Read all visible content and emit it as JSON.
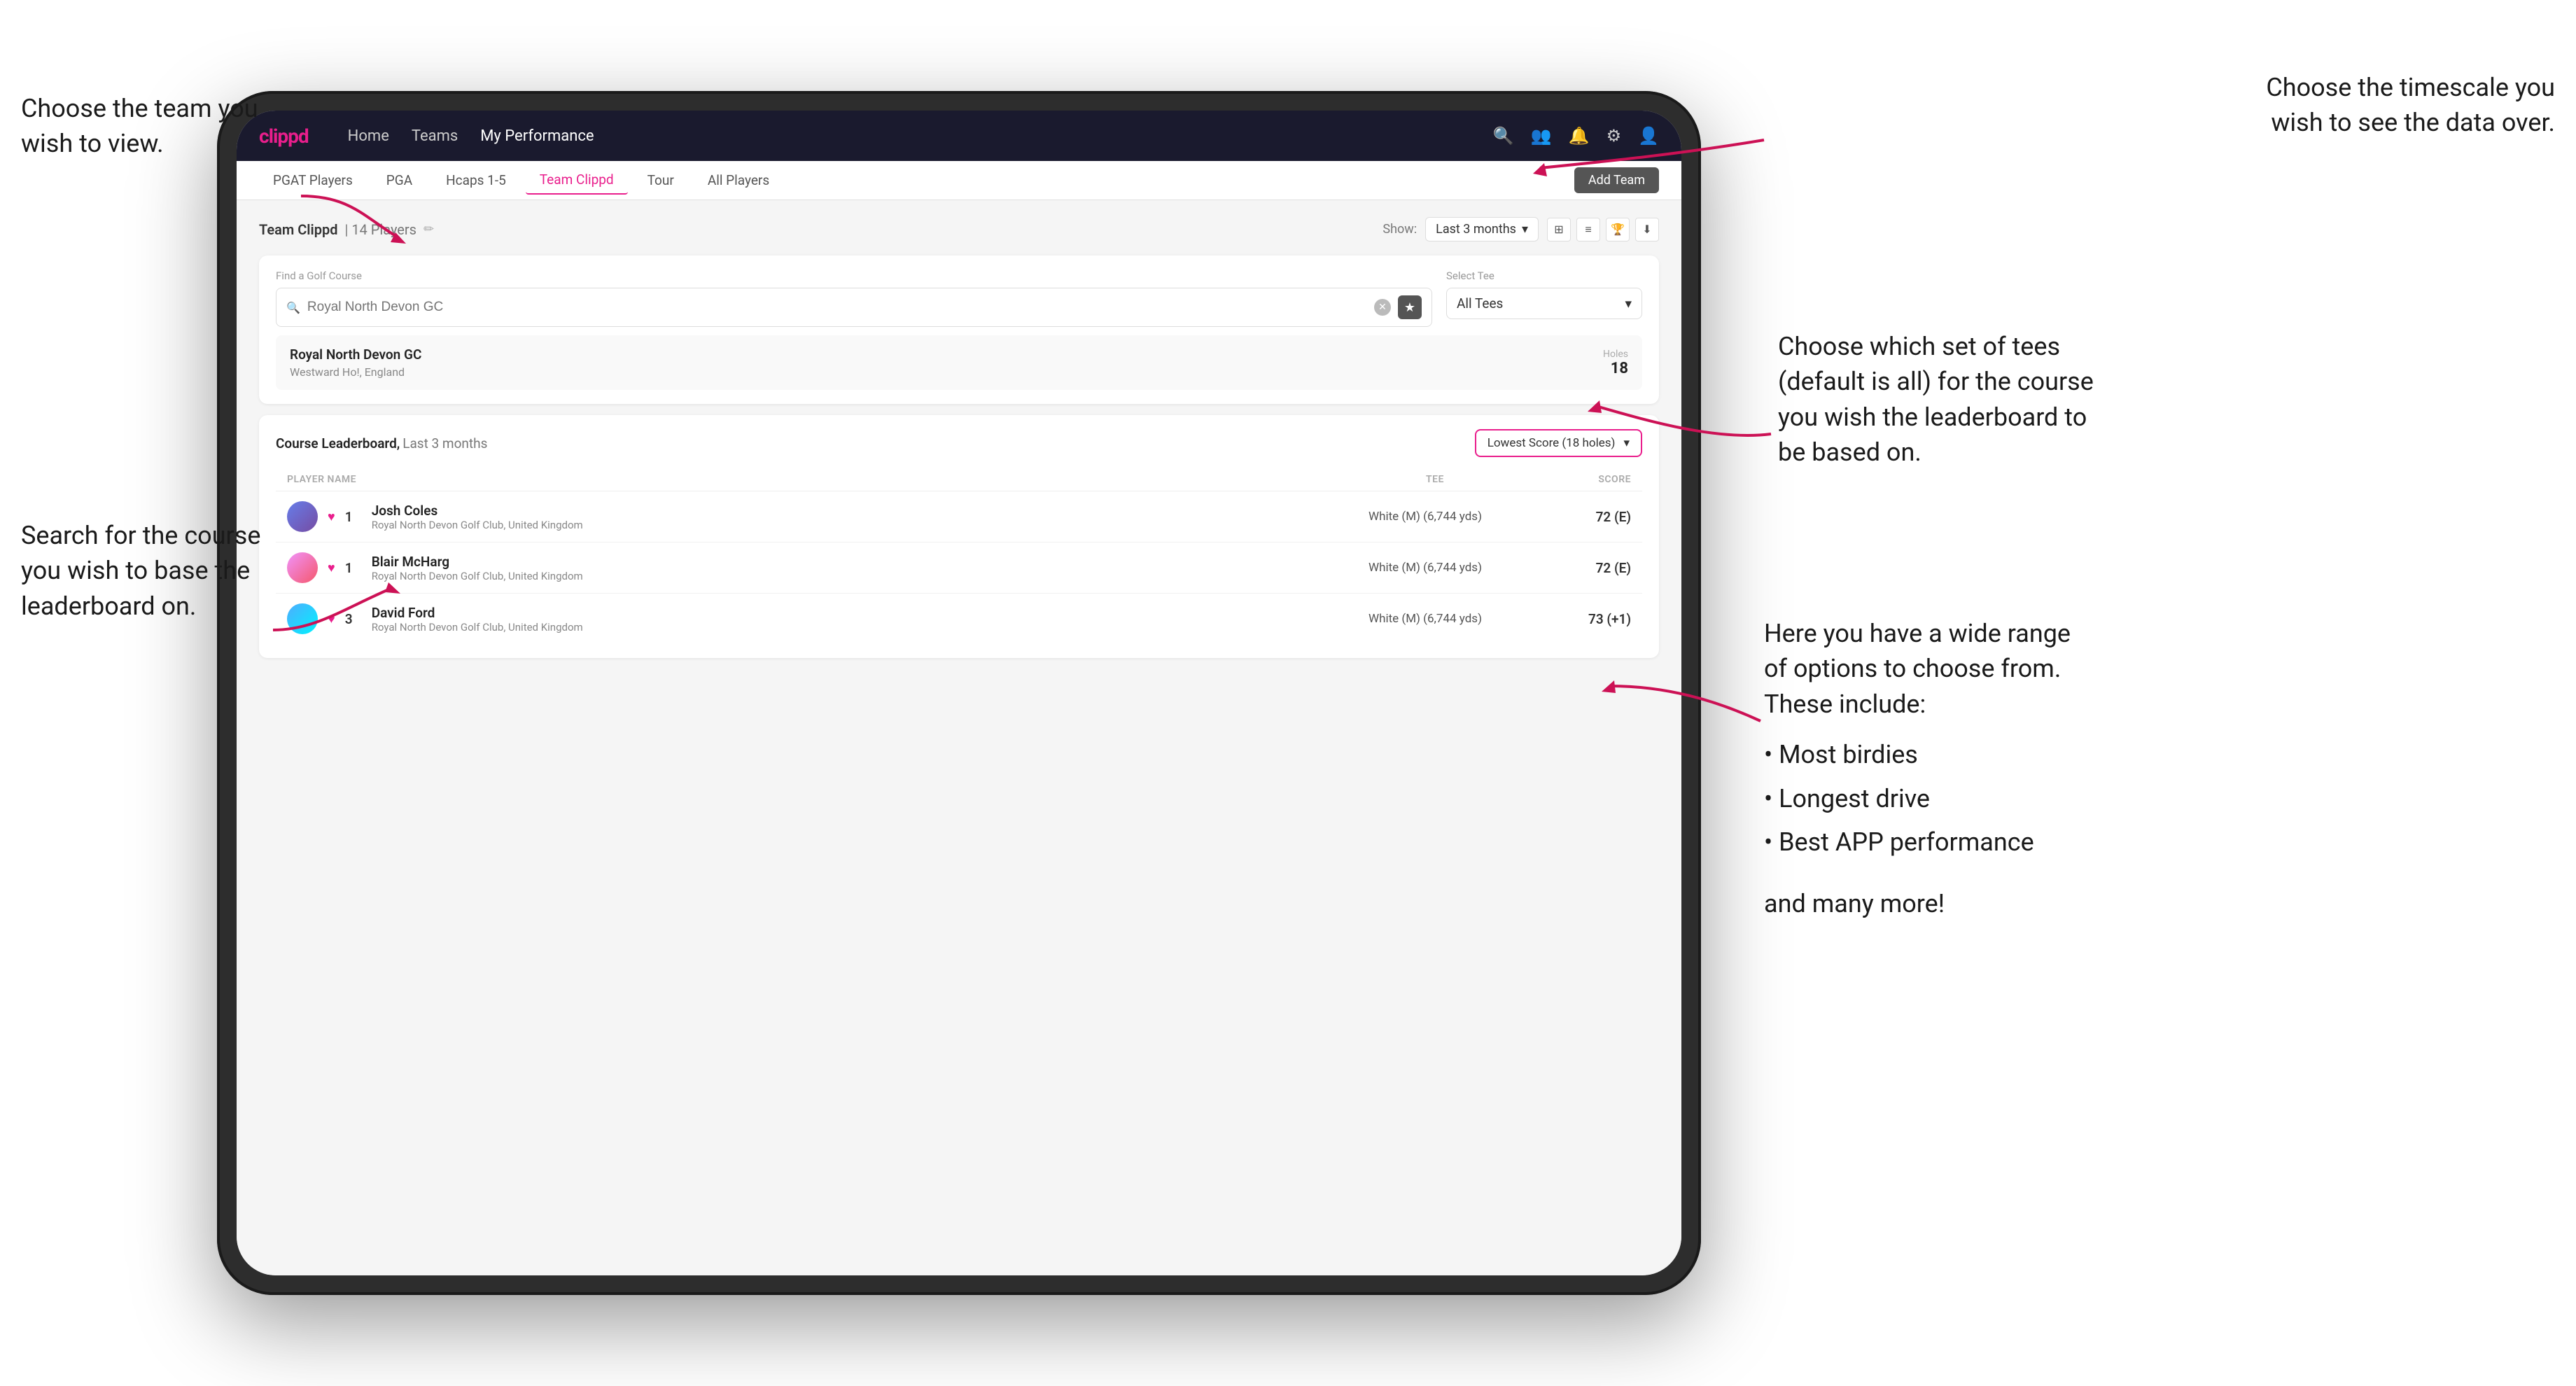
{
  "annotations": {
    "top_left_title": "Choose the team you\nwish to view.",
    "bottom_left_title": "Search for the course\nyou wish to base the\nleaderboard on.",
    "top_right_title": "Choose the timescale you\nwish to see the data over.",
    "mid_right_title": "Choose which set of tees\n(default is all) for the course\nyou wish the leaderboard to\nbe based on.",
    "bottom_right_title": "Here you have a wide range\nof options to choose from.\nThese include:",
    "options": [
      "Most birdies",
      "Longest drive",
      "Best APP performance"
    ],
    "and_more": "and many more!"
  },
  "nav": {
    "logo": "clippd",
    "links": [
      "Home",
      "Teams",
      "My Performance"
    ],
    "active_link": "My Performance"
  },
  "sub_nav": {
    "tabs": [
      "PGAT Players",
      "PGA",
      "Hcaps 1-5",
      "Team Clippd",
      "Tour",
      "All Players"
    ],
    "active_tab": "Team Clippd",
    "add_button": "Add Team"
  },
  "team_header": {
    "title": "Team Clippd",
    "count": "14 Players",
    "show_label": "Show:",
    "show_value": "Last 3 months"
  },
  "search": {
    "find_label": "Find a Golf Course",
    "placeholder": "Royal North Devon GC",
    "select_tee_label": "Select Tee",
    "tee_value": "All Tees"
  },
  "course_result": {
    "name": "Royal North Devon GC",
    "location": "Westward Ho!, England",
    "holes_label": "Holes",
    "holes": "18"
  },
  "leaderboard": {
    "title": "Course Leaderboard,",
    "subtitle": "Last 3 months",
    "filter": "Lowest Score (18 holes)",
    "columns": {
      "player": "PLAYER NAME",
      "tee": "TEE",
      "score": "SCORE"
    },
    "rows": [
      {
        "rank": "1",
        "name": "Josh Coles",
        "club": "Royal North Devon Golf Club, United Kingdom",
        "tee": "White (M) (6,744 yds)",
        "score": "72 (E)"
      },
      {
        "rank": "1",
        "name": "Blair McHarg",
        "club": "Royal North Devon Golf Club, United Kingdom",
        "tee": "White (M) (6,744 yds)",
        "score": "72 (E)"
      },
      {
        "rank": "3",
        "name": "David Ford",
        "club": "Royal North Devon Golf Club, United Kingdom",
        "tee": "White (M) (6,744 yds)",
        "score": "73 (+1)"
      }
    ]
  }
}
